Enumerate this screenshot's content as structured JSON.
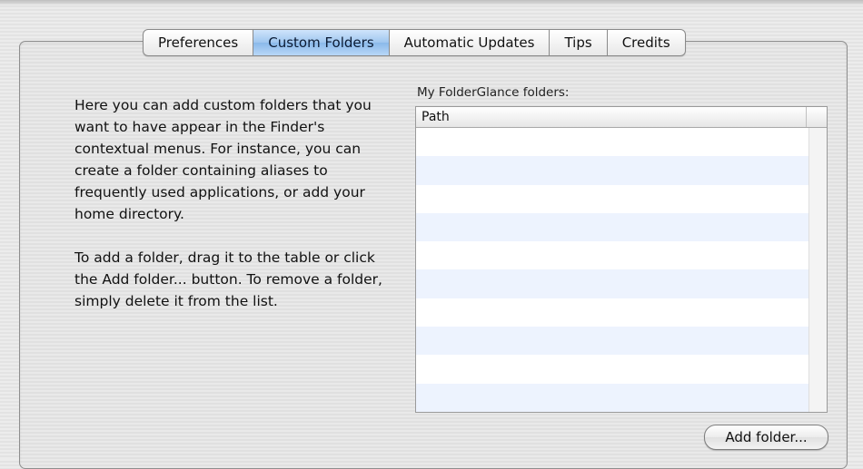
{
  "tabs": [
    {
      "label": "Preferences",
      "active": false
    },
    {
      "label": "Custom Folders",
      "active": true
    },
    {
      "label": "Automatic Updates",
      "active": false
    },
    {
      "label": "Tips",
      "active": false
    },
    {
      "label": "Credits",
      "active": false
    }
  ],
  "description": {
    "paragraph1": "Here you can add custom folders that you want to have appear in the Finder's contextual menus. For instance, you can create a folder containing aliases to frequently used applications, or add your home directory.",
    "paragraph2": "To add a folder, drag it to the table or click the Add folder... button. To remove a folder, simply delete it from the list."
  },
  "folders_table": {
    "label": "My FolderGlance folders:",
    "columns": [
      "Path"
    ],
    "rows": []
  },
  "buttons": {
    "add_folder": "Add folder..."
  },
  "colors": {
    "active_tab": "#9fc6ef",
    "alt_row": "#edf3fe"
  }
}
